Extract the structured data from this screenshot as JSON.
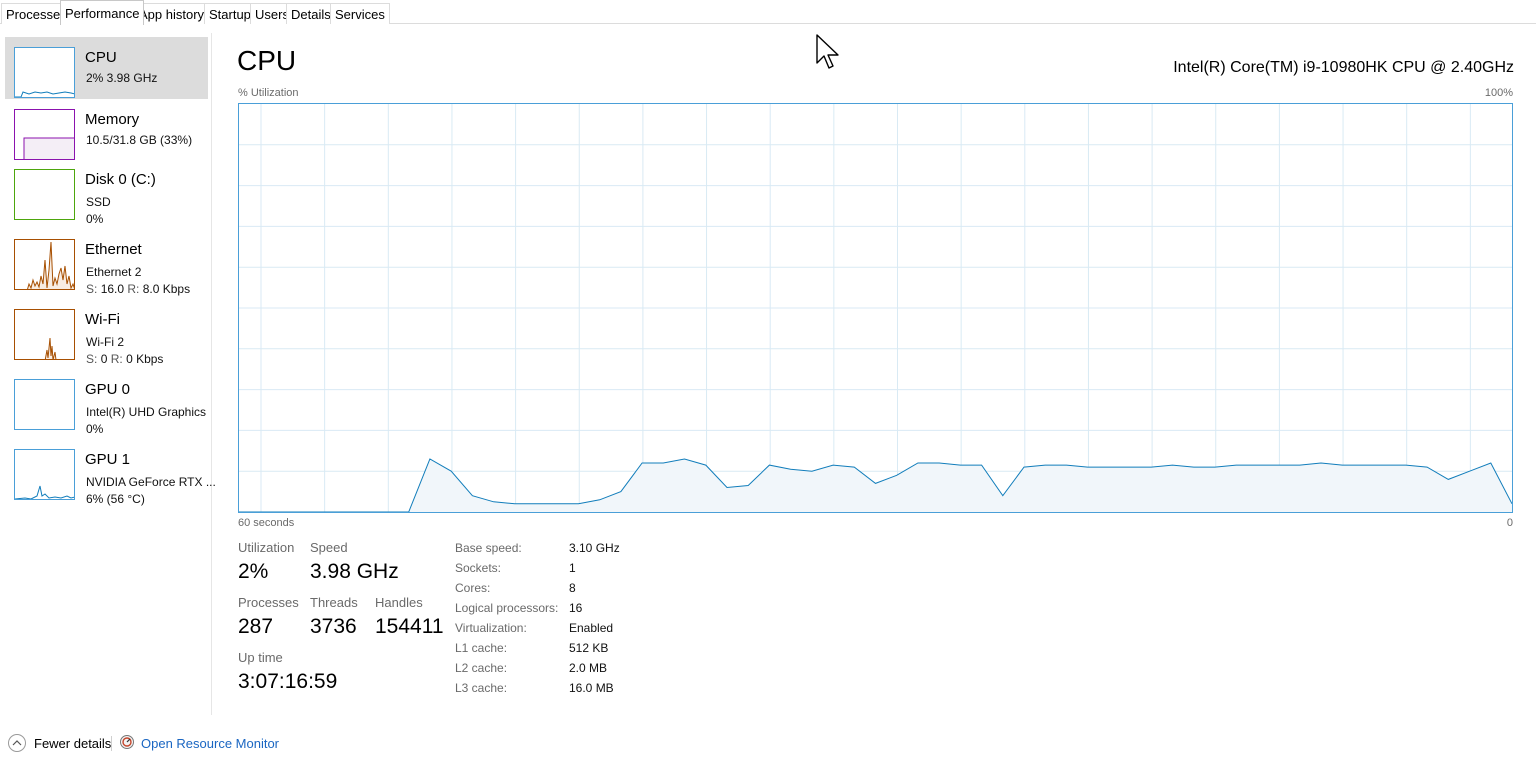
{
  "tabs": [
    {
      "label": "Processes",
      "active": false
    },
    {
      "label": "Performance",
      "active": true
    },
    {
      "label": "App history",
      "active": false
    },
    {
      "label": "Startup",
      "active": false
    },
    {
      "label": "Users",
      "active": false
    },
    {
      "label": "Details",
      "active": false
    },
    {
      "label": "Services",
      "active": false
    }
  ],
  "sidebar": {
    "items": [
      {
        "title": "CPU",
        "line1": "2%  3.98 GHz",
        "line2": "",
        "color": "#117dbb",
        "selected": true
      },
      {
        "title": "Memory",
        "line1": "10.5/31.8 GB (33%)",
        "line2": "",
        "color": "#8b12ae",
        "selected": false
      },
      {
        "title": "Disk 0 (C:)",
        "line1": "SSD",
        "line2": "0%",
        "color": "#4da60c",
        "selected": false
      },
      {
        "title": "Ethernet",
        "line1": "Ethernet 2",
        "line2_s_label": "S:",
        "line2_s_value": "16.0",
        "line2_r_label": "R:",
        "line2_r_value": "8.0 Kbps",
        "color": "#a74f01",
        "selected": false
      },
      {
        "title": "Wi-Fi",
        "line1": "Wi-Fi 2",
        "line2_s_label": "S:",
        "line2_s_value": "0",
        "line2_r_label": "R:",
        "line2_r_value": "0 Kbps",
        "color": "#a74f01",
        "selected": false
      },
      {
        "title": "GPU 0",
        "line1": "Intel(R) UHD Graphics",
        "line2": "0%",
        "color": "#117dbb",
        "selected": false
      },
      {
        "title": "GPU 1",
        "line1": "NVIDIA GeForce RTX ...",
        "line2": "6%  (56 °C)",
        "color": "#117dbb",
        "selected": false
      }
    ]
  },
  "main": {
    "title": "CPU",
    "model": "Intel(R) Core(TM) i9-10980HK CPU @ 2.40GHz",
    "graph": {
      "y_label": "% Utilization",
      "y_max_label": "100%",
      "x_left_label": "60 seconds",
      "x_right_label": "0"
    },
    "stats": {
      "utilization_label": "Utilization",
      "utilization_value": "2%",
      "speed_label": "Speed",
      "speed_value": "3.98 GHz",
      "processes_label": "Processes",
      "processes_value": "287",
      "threads_label": "Threads",
      "threads_value": "3736",
      "handles_label": "Handles",
      "handles_value": "154411",
      "uptime_label": "Up time",
      "uptime_value": "3:07:16:59"
    },
    "specs": [
      {
        "label": "Base speed:",
        "value": "3.10 GHz"
      },
      {
        "label": "Sockets:",
        "value": "1"
      },
      {
        "label": "Cores:",
        "value": "8"
      },
      {
        "label": "Logical processors:",
        "value": "16"
      },
      {
        "label": "Virtualization:",
        "value": "Enabled"
      },
      {
        "label": "L1 cache:",
        "value": "512 KB"
      },
      {
        "label": "L2 cache:",
        "value": "2.0 MB"
      },
      {
        "label": "L3 cache:",
        "value": "16.0 MB"
      }
    ]
  },
  "footer": {
    "fewer_details": "Fewer details",
    "open_resource_monitor": "Open Resource Monitor"
  },
  "chart_data": {
    "type": "area",
    "x": [
      60,
      59,
      58,
      57,
      56,
      55,
      54,
      53,
      52,
      51,
      50,
      49,
      48,
      47,
      46,
      45,
      44,
      43,
      42,
      41,
      40,
      39,
      38,
      37,
      36,
      35,
      34,
      33,
      32,
      31,
      30,
      29,
      28,
      27,
      26,
      25,
      24,
      23,
      22,
      21,
      20,
      19,
      18,
      17,
      16,
      15,
      14,
      13,
      12,
      11,
      10,
      9,
      8,
      7,
      6,
      5,
      4,
      3,
      2,
      1,
      0
    ],
    "series": [
      {
        "values": [
          0,
          0,
          0,
          0,
          0,
          0,
          0,
          0,
          0,
          13,
          10,
          4,
          2.5,
          2,
          2,
          2,
          2,
          3,
          5,
          12,
          12,
          13,
          11.5,
          6,
          6.5,
          11.5,
          10.5,
          10,
          11.5,
          11,
          7,
          9,
          12,
          12,
          11.5,
          11.5,
          4,
          11,
          11.5,
          11.5,
          11,
          11,
          11,
          11,
          11.5,
          11,
          11,
          11.5,
          11.5,
          11.5,
          11.5,
          12,
          11.5,
          11.5,
          11.5,
          11.5,
          11,
          8,
          10,
          12,
          2
        ]
      }
    ],
    "xlabel": "60 seconds",
    "ylabel": "% Utilization",
    "ylim": [
      0,
      100
    ],
    "grid": true,
    "line_color": "#117dbb",
    "fill_color": "#f1f6fa"
  }
}
